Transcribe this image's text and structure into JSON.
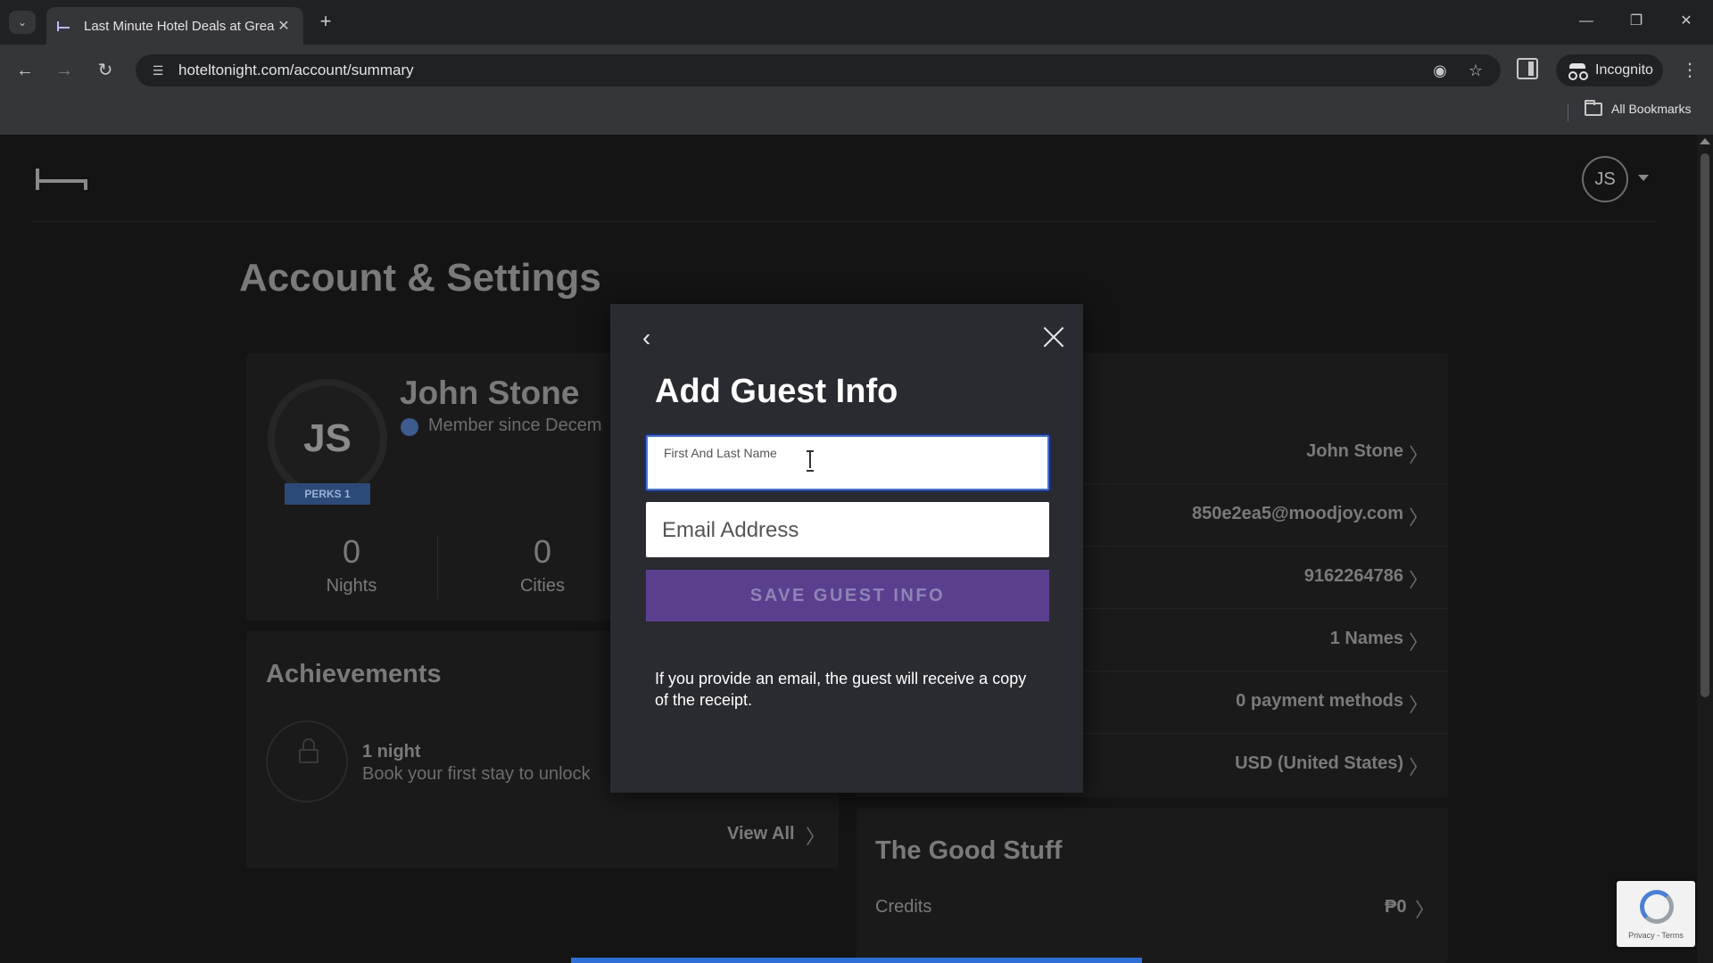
{
  "browser": {
    "tab_title": "Last Minute Hotel Deals at Grea",
    "url": "hoteltonight.com/account/summary",
    "incognito_label": "Incognito",
    "bookmarks_label": "All Bookmarks"
  },
  "header": {
    "avatar_initials": "JS"
  },
  "page": {
    "title": "Account & Settings"
  },
  "profile": {
    "initials": "JS",
    "perks_badge": "PERKS 1",
    "name": "John Stone",
    "member_since": "Member since Decem",
    "stats": [
      {
        "value": "0",
        "label": "Nights"
      },
      {
        "value": "0",
        "label": "Cities"
      }
    ]
  },
  "achievements": {
    "title": "Achievements",
    "item_title": "1 night",
    "item_desc": "Book your first stay to unlock",
    "view_all": "View All"
  },
  "settings": {
    "rows": [
      {
        "value": "John Stone"
      },
      {
        "value": "850e2ea5@moodjoy.com"
      },
      {
        "value": "9162264786"
      },
      {
        "value": "1 Names"
      },
      {
        "value": "0 payment methods"
      },
      {
        "value": "USD (United States)"
      }
    ]
  },
  "good_stuff": {
    "title": "The Good Stuff",
    "credits_label": "Credits",
    "credits_value": "₱0"
  },
  "recaptcha": {
    "text": "Privacy - Terms"
  },
  "modal": {
    "title": "Add Guest Info",
    "name_label": "First And Last Name",
    "name_value": "",
    "email_placeholder": "Email Address",
    "save_label": "SAVE GUEST INFO",
    "note": "If you provide an email, the guest will receive a copy of the receipt."
  },
  "colors": {
    "modal_bg": "#2a2b30",
    "save_button": "#5b3f8f",
    "focus_border": "#4a6fd0"
  }
}
